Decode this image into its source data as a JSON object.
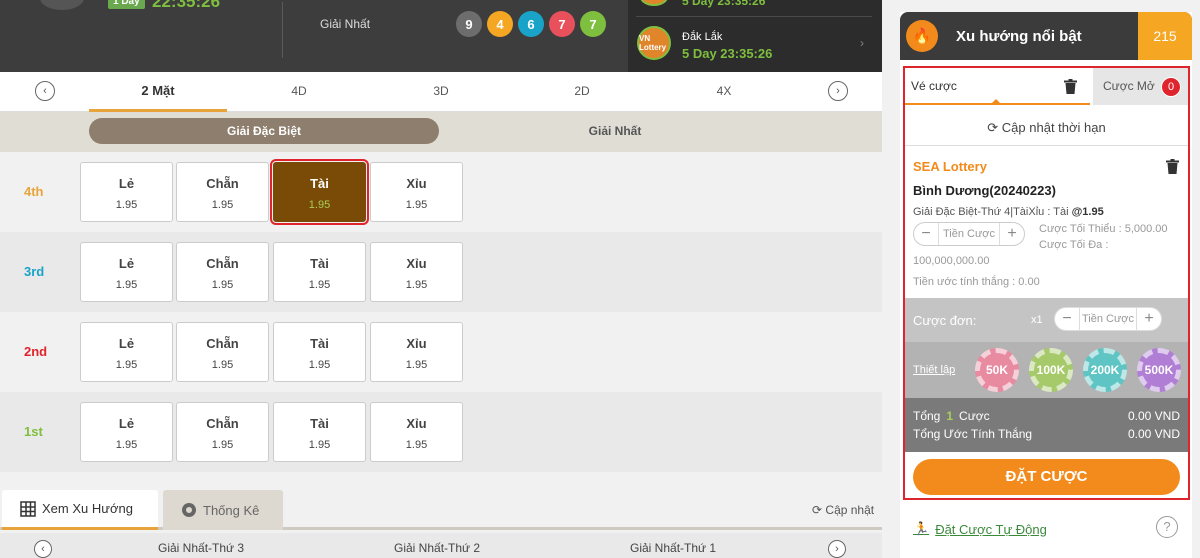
{
  "topbar": {
    "badge": "1 Day",
    "time_top": "22:35:26",
    "label": "Giải Nhất",
    "balls": [
      {
        "n": "9",
        "c": "#6d6d6d"
      },
      {
        "n": "4",
        "c": "#f5a623"
      },
      {
        "n": "6",
        "c": "#1aa3c9"
      },
      {
        "n": "7",
        "c": "#e8505b"
      },
      {
        "n": "7",
        "c": "#7fbf3f"
      }
    ],
    "right_time_top": "5 Day 23:35:26",
    "right_name": "Đắk Lắk",
    "right_time": "5 Day 23:35:26",
    "right_logo": "VN Lottery"
  },
  "tabs": [
    {
      "label": "2 Mặt",
      "active": true
    },
    {
      "label": "4D"
    },
    {
      "label": "3D"
    },
    {
      "label": "2D"
    },
    {
      "label": "4X"
    }
  ],
  "subtabs": [
    "Giải Đặc Biệt",
    "Giải Nhất"
  ],
  "rows": [
    {
      "label": "4th",
      "color": "#e8a43a",
      "cells": [
        {
          "name": "Lẻ",
          "odd": "1.95"
        },
        {
          "name": "Chẵn",
          "odd": "1.95"
        },
        {
          "name": "Tài",
          "odd": "1.95",
          "selected": true
        },
        {
          "name": "Xỉu",
          "odd": "1.95"
        }
      ]
    },
    {
      "label": "3rd",
      "color": "#1aa3c9",
      "cells": [
        {
          "name": "Lẻ",
          "odd": "1.95"
        },
        {
          "name": "Chẵn",
          "odd": "1.95"
        },
        {
          "name": "Tài",
          "odd": "1.95"
        },
        {
          "name": "Xỉu",
          "odd": "1.95"
        }
      ]
    },
    {
      "label": "2nd",
      "color": "#e0242d",
      "cells": [
        {
          "name": "Lẻ",
          "odd": "1.95"
        },
        {
          "name": "Chẵn",
          "odd": "1.95"
        },
        {
          "name": "Tài",
          "odd": "1.95"
        },
        {
          "name": "Xỉu",
          "odd": "1.95"
        }
      ]
    },
    {
      "label": "1st",
      "color": "#7fbf3f",
      "cells": [
        {
          "name": "Lẻ",
          "odd": "1.95"
        },
        {
          "name": "Chẵn",
          "odd": "1.95"
        },
        {
          "name": "Tài",
          "odd": "1.95"
        },
        {
          "name": "Xỉu",
          "odd": "1.95"
        }
      ]
    }
  ],
  "bottom": {
    "tab1": "Xem Xu Hướng",
    "tab2": "Thống Kê",
    "update": "Cập nhật",
    "nav": [
      "Giải Nhất-Thứ 3",
      "Giải Nhất-Thứ 2",
      "Giải Nhất-Thứ 1"
    ]
  },
  "panel": {
    "title": "Xu hướng nổi bật",
    "count": "215",
    "tab_slip": "Vé cược",
    "tab_open": "Cược Mở",
    "open_count": "0",
    "refresh": "Cập nhật thời hạn",
    "provider": "SEA Lottery",
    "event": "Bình Dương(20240223)",
    "selection": "Giải Đặc Biệt-Thứ 4|TàiXỉu : Tài",
    "odds": "@1.95",
    "amount_placeholder": "Tiền Cược",
    "min_bet": "Cược Tối Thiểu : 5,000.00",
    "max_bet": "Cược Tối Đa :",
    "max_value": "100,000,000.00",
    "win_est": "Tiền ước tính thắng : 0.00",
    "single_label": "Cược đơn:",
    "single_mult": "x1",
    "setup": "Thiết lập",
    "chips": [
      {
        "label": "50K",
        "color": "#e88aa0"
      },
      {
        "label": "100K",
        "color": "#a6c96a"
      },
      {
        "label": "200K",
        "color": "#5ec4c4"
      },
      {
        "label": "500K",
        "color": "#b07ed4"
      }
    ],
    "total_label": "Tổng",
    "total_count": "1",
    "total_suffix": "Cược",
    "total_value": "0.00 VND",
    "win_label": "Tổng Ước Tính Thắng",
    "win_value": "0.00 VND",
    "place_bet": "ĐẶT CƯỢC",
    "auto_bet": "Đặt Cược Tự Động",
    "help": "?"
  }
}
